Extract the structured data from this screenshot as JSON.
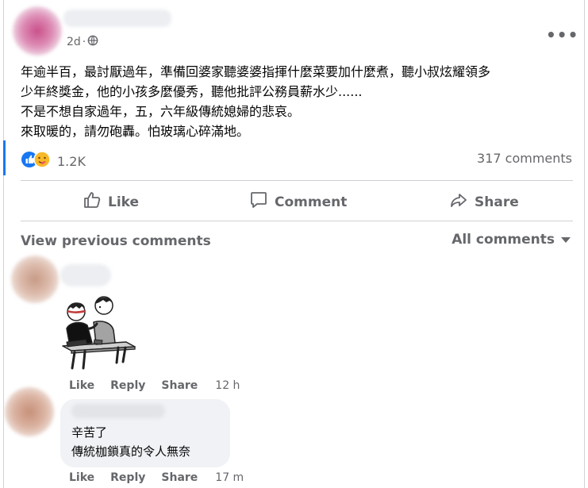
{
  "post": {
    "time": "2d",
    "separator": "·",
    "privacy_icon": "globe-icon",
    "more_icon": "ellipsis-icon",
    "text_lines": [
      "年逾半百，最討厭過年，準備回婆家聽婆婆指揮什麼菜要加什麼煮，聽小叔炫耀領多",
      "少年終獎金，他的小孩多麼優秀，聽他批評公務員薪水少......",
      "不是不想自家過年，五，六年級傳統媳婦的悲哀。",
      "來取暖的，請勿砲轟。怕玻璃心碎滿地。"
    ],
    "reaction_count": "1.2K",
    "comments_count": "317 comments"
  },
  "actions": {
    "like": "Like",
    "comment": "Comment",
    "share": "Share"
  },
  "comments_header": {
    "view_previous": "View previous comments",
    "filter": "All comments"
  },
  "comments": [
    {
      "sticker": "friends-on-bench-sticker",
      "like": "Like",
      "reply": "Reply",
      "share": "Share",
      "time": "12 h"
    },
    {
      "lines": [
        "辛苦了",
        "傳統枷鎖真的令人無奈"
      ],
      "like": "Like",
      "reply": "Reply",
      "share": "Share",
      "time": "17 m"
    }
  ],
  "colors": {
    "accent": "#1877f2",
    "secondary_text": "#65676b",
    "bubble_bg": "#f0f2f5"
  }
}
